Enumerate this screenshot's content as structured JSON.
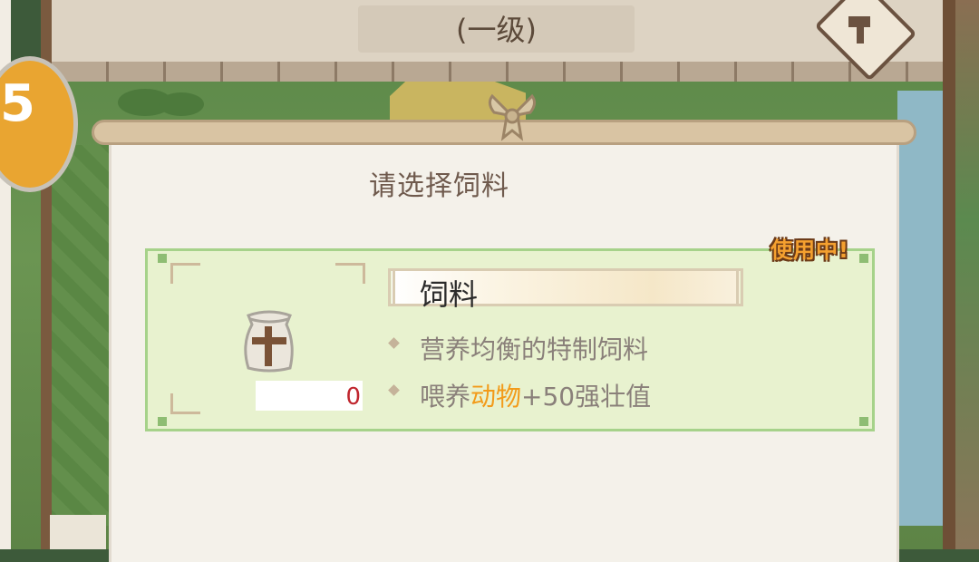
{
  "header": {
    "level_label": "(一级)",
    "hammer_button_icon": "hammer-icon",
    "coin_button_icon": "coin-icon",
    "coin_glyph": "5"
  },
  "dialog": {
    "title": "请选择饲料",
    "in_use_badge": "使用中!",
    "item": {
      "icon": "feed-sack-icon",
      "count": "0",
      "name": "饲料",
      "description": "营养均衡的特制饲料",
      "effect_prefix": "喂养",
      "effect_target": "动物",
      "effect_suffix": "+50强壮值"
    }
  },
  "colors": {
    "card_background": "#e8f2cf",
    "card_border": "#a6d28a",
    "badge_fill": "#f4a02f",
    "highlight_text": "#f29b1a",
    "count_text": "#c0262e",
    "title_text": "#6f5a4d"
  }
}
